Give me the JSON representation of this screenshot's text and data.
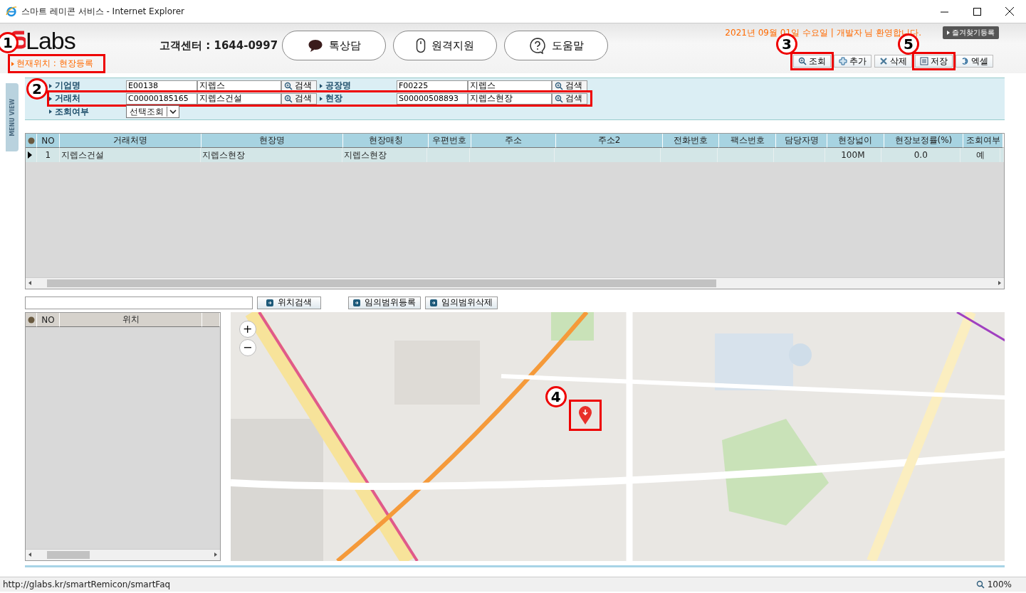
{
  "window": {
    "title": "스마트 레미콘 서비스 - Internet Explorer"
  },
  "header": {
    "logo": "Labs",
    "support": "고객센터 : 1644-0997",
    "buttons": [
      {
        "label": "톡상담"
      },
      {
        "label": "원격지원"
      },
      {
        "label": "도움말"
      }
    ],
    "welcome": "2021년 09월 01일 수요일 | 개발자 님 환영합니다.",
    "favorites": "즐겨찾기등록"
  },
  "location": {
    "text": "현재위치 : 현장등록",
    "callout": "1"
  },
  "toolbar": [
    {
      "label": "조회",
      "callout": "3"
    },
    {
      "label": "추가"
    },
    {
      "label": "삭제"
    },
    {
      "label": "저장",
      "callout": "5"
    },
    {
      "label": "엑셀"
    }
  ],
  "sidebar_tab": "MENU VIEW",
  "filters": [
    {
      "kind": "pair",
      "fields": [
        {
          "label": "기업명",
          "code": "E00138",
          "name": "지렙스",
          "button": "검색"
        },
        {
          "label": "공장명",
          "code": "F00225",
          "name": "지렙스",
          "button": "검색"
        }
      ]
    },
    {
      "kind": "pair",
      "callout": "2",
      "fields": [
        {
          "label": "거래처",
          "code": "C00000185165",
          "name": "지렙스건설",
          "button": "검색"
        },
        {
          "label": "현장",
          "code": "S00000508893",
          "name": "지렙스현장",
          "button": "검색"
        }
      ]
    },
    {
      "kind": "select",
      "label": "조회여부",
      "value": "선택조회"
    }
  ],
  "grid": {
    "columns": [
      "NO",
      "거래처명",
      "현장명",
      "현장매칭",
      "우편번호",
      "주소",
      "주소2",
      "전화번호",
      "팩스번호",
      "담당자명",
      "현장넓이",
      "현장보정률(%)",
      "조회여부"
    ],
    "rows": [
      {
        "selected": true,
        "cells": [
          "1",
          "지렙스건설",
          "지렙스현장",
          "지렙스현장",
          null,
          null,
          null,
          null,
          null,
          null,
          "100M",
          "0.0",
          "예"
        ]
      }
    ]
  },
  "location_search": {
    "buttons": [
      "위치검색",
      "임의범위등록",
      "임의범위삭제"
    ]
  },
  "location_grid": {
    "columns": [
      "NO",
      "위치"
    ]
  },
  "map": {
    "kind": "picture",
    "zoom_in": "+",
    "zoom_out": "−",
    "marker_callout": "4"
  },
  "status_bar": {
    "url": "http://glabs.kr/smartRemicon/smartFaq",
    "zoom": "100%"
  }
}
